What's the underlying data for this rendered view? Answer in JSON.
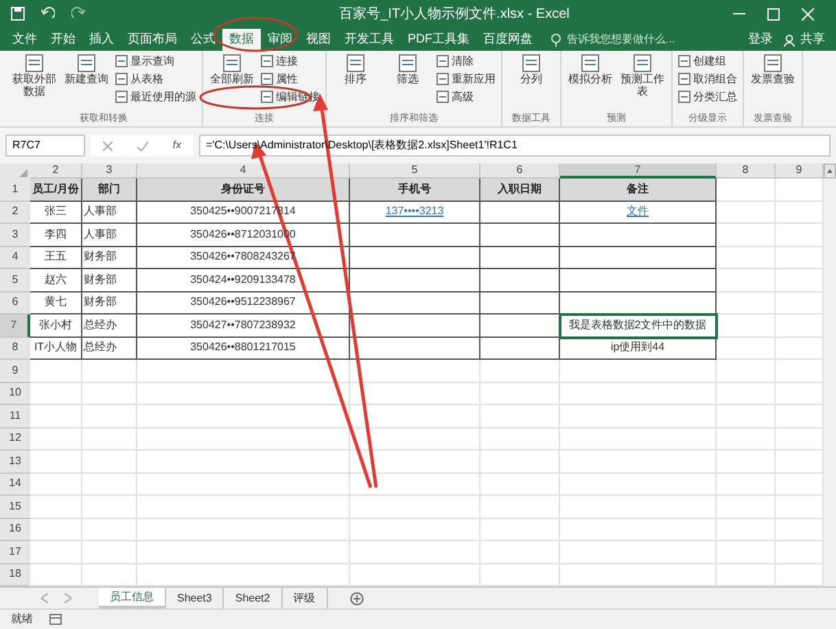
{
  "window": {
    "title": "百家号_IT小人物示例文件.xlsx - Excel"
  },
  "ribbon_tabs": [
    {
      "label": "文件",
      "selected": false
    },
    {
      "label": "开始",
      "selected": false
    },
    {
      "label": "插入",
      "selected": false
    },
    {
      "label": "页面布局",
      "selected": false
    },
    {
      "label": "公式",
      "selected": false
    },
    {
      "label": "数据",
      "selected": true
    },
    {
      "label": "审阅",
      "selected": false
    },
    {
      "label": "视图",
      "selected": false
    },
    {
      "label": "开发工具",
      "selected": false
    },
    {
      "label": "PDF工具集",
      "selected": false
    },
    {
      "label": "百度网盘",
      "selected": false
    }
  ],
  "tell_me": {
    "placeholder": "告诉我您想要做什么..."
  },
  "account": {
    "sign_in": "登录",
    "share": "共享"
  },
  "ribbon_groups": [
    {
      "label": "获取和转换",
      "items": [
        {
          "label": "获取外部数据",
          "kind": "large"
        },
        {
          "label": "新建查询",
          "kind": "large"
        },
        {
          "label": "显示查询",
          "kind": "small"
        },
        {
          "label": "从表格",
          "kind": "small"
        },
        {
          "label": "最近使用的源",
          "kind": "small"
        }
      ]
    },
    {
      "label": "连接",
      "items": [
        {
          "label": "全部刷新",
          "kind": "large"
        },
        {
          "label": "连接",
          "kind": "small"
        },
        {
          "label": "属性",
          "kind": "small"
        },
        {
          "label": "编辑链接",
          "kind": "small"
        }
      ]
    },
    {
      "label": "排序和筛选",
      "items": [
        {
          "label": "排序",
          "kind": "large"
        },
        {
          "label": "筛选",
          "kind": "large"
        },
        {
          "label": "清除",
          "kind": "small"
        },
        {
          "label": "重新应用",
          "kind": "small"
        },
        {
          "label": "高级",
          "kind": "small"
        }
      ]
    },
    {
      "label": "数据工具",
      "items": [
        {
          "label": "分列",
          "kind": "large"
        }
      ]
    },
    {
      "label": "预测",
      "items": [
        {
          "label": "模拟分析",
          "kind": "large"
        },
        {
          "label": "预测工作表",
          "kind": "large"
        }
      ]
    },
    {
      "label": "分级显示",
      "items": [
        {
          "label": "创建组",
          "kind": "small"
        },
        {
          "label": "取消组合",
          "kind": "small"
        },
        {
          "label": "分类汇总",
          "kind": "small"
        }
      ]
    },
    {
      "label": "发票查验",
      "items": [
        {
          "label": "发票查验",
          "kind": "large"
        }
      ]
    }
  ],
  "formula_bar": {
    "name_box": "R7C7",
    "function_symbol": "fx",
    "formula": "='C:\\Users\\Administrator\\Desktop\\[表格数据2.xlsx]Sheet1'!R1C1"
  },
  "columns": [
    {
      "label": "2",
      "selected": false
    },
    {
      "label": "3",
      "selected": false
    },
    {
      "label": "4",
      "selected": false
    },
    {
      "label": "5",
      "selected": false
    },
    {
      "label": "6",
      "selected": false
    },
    {
      "label": "7",
      "selected": true
    },
    {
      "label": "8",
      "selected": false
    },
    {
      "label": "9",
      "selected": false
    }
  ],
  "rows": [
    {
      "number": "1",
      "selected": false,
      "cells": [
        {
          "text": "员工/月份",
          "kind": "header"
        },
        {
          "text": "部门",
          "kind": "header"
        },
        {
          "text": "身份证号",
          "kind": "header"
        },
        {
          "text": "手机号",
          "kind": "header"
        },
        {
          "text": "入职日期",
          "kind": "header"
        },
        {
          "text": "备注",
          "kind": "header"
        }
      ]
    },
    {
      "number": "2",
      "selected": false,
      "cells": [
        {
          "text": "张三",
          "kind": "text"
        },
        {
          "text": "人事部",
          "kind": "text"
        },
        {
          "text": "350425••9007217814",
          "kind": "text"
        },
        {
          "text": "137••••3213",
          "kind": "link"
        },
        null,
        {
          "text": "文件",
          "kind": "link"
        }
      ]
    },
    {
      "number": "3",
      "selected": false,
      "cells": [
        {
          "text": "李四",
          "kind": "text"
        },
        {
          "text": "人事部",
          "kind": "text"
        },
        {
          "text": "350426••8712031000",
          "kind": "text"
        },
        null,
        null,
        null
      ]
    },
    {
      "number": "4",
      "selected": false,
      "cells": [
        {
          "text": "王五",
          "kind": "text"
        },
        {
          "text": "财务部",
          "kind": "text"
        },
        {
          "text": "350426••7808243267",
          "kind": "text"
        },
        null,
        null,
        null
      ]
    },
    {
      "number": "5",
      "selected": false,
      "cells": [
        {
          "text": "赵六",
          "kind": "text"
        },
        {
          "text": "财务部",
          "kind": "text"
        },
        {
          "text": "350424••9209133478",
          "kind": "text"
        },
        null,
        null,
        null
      ]
    },
    {
      "number": "6",
      "selected": false,
      "cells": [
        {
          "text": "黄七",
          "kind": "text"
        },
        {
          "text": "财务部",
          "kind": "text"
        },
        {
          "text": "350426••9512238967",
          "kind": "text"
        },
        null,
        null,
        null
      ]
    },
    {
      "number": "7",
      "selected": true,
      "cells": [
        {
          "text": "张小村",
          "kind": "text"
        },
        {
          "text": "总经办",
          "kind": "text"
        },
        {
          "text": "350427••7807238932",
          "kind": "text"
        },
        null,
        null,
        {
          "text": "我是表格数据2文件中的数据",
          "kind": "text"
        }
      ]
    },
    {
      "number": "8",
      "selected": false,
      "cells": [
        {
          "text": "IT小人物",
          "kind": "text"
        },
        {
          "text": "总经办",
          "kind": "text"
        },
        {
          "text": "350426••8801217015",
          "kind": "text"
        },
        null,
        null,
        {
          "text": "ip使用到44",
          "kind": "text"
        }
      ]
    }
  ],
  "empty_rows": [
    "9",
    "10",
    "11",
    "12",
    "13",
    "14",
    "15",
    "16",
    "17",
    "18"
  ],
  "sheet_tabs": [
    {
      "label": "员工信息",
      "selected": true
    },
    {
      "label": "Sheet3",
      "selected": false
    },
    {
      "label": "Sheet2",
      "selected": false
    },
    {
      "label": "评级",
      "selected": false
    }
  ],
  "status_bar": {
    "status": "就绪"
  }
}
